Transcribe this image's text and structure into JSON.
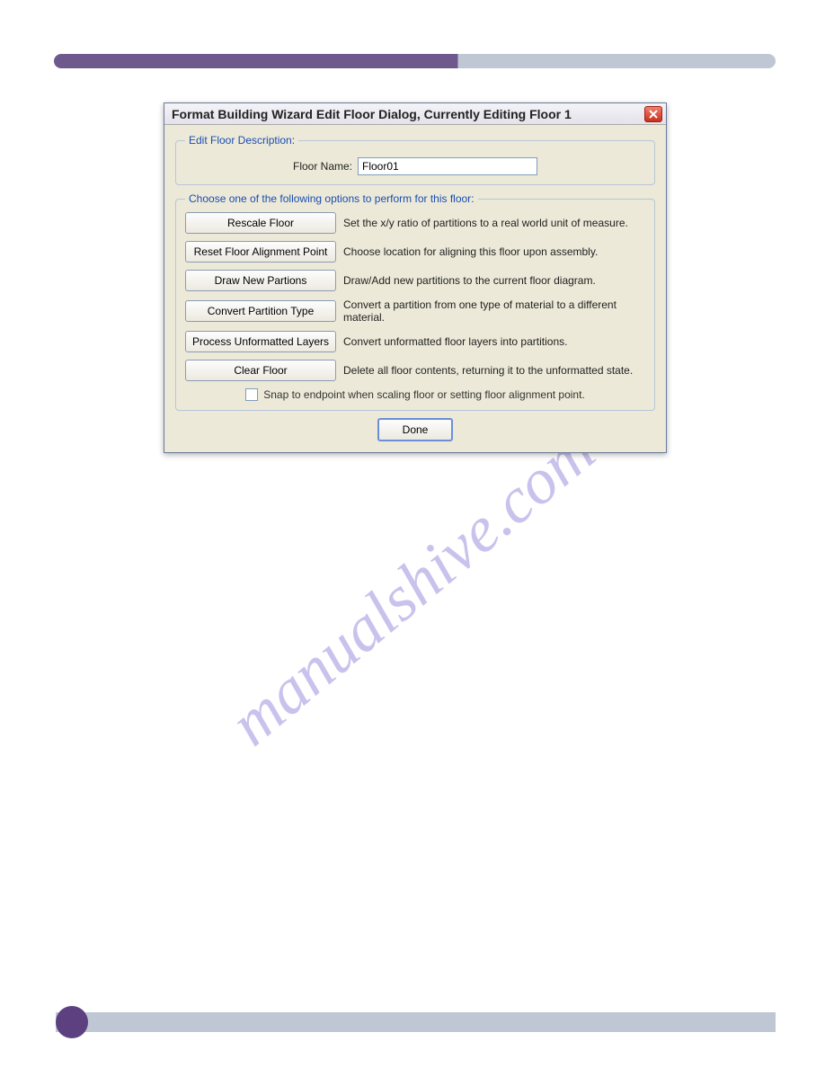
{
  "watermark": "manualshive.com",
  "dialog": {
    "title": "Format Building Wizard Edit Floor Dialog, Currently Editing Floor 1",
    "groups": {
      "description": {
        "legend": "Edit Floor Description:",
        "floorNameLabel": "Floor Name:",
        "floorNameValue": "Floor01"
      },
      "options": {
        "legend": "Choose one of the following options to perform for this floor:",
        "rows": [
          {
            "button": "Rescale Floor",
            "desc": "Set the x/y ratio of partitions to a real world unit of measure."
          },
          {
            "button": "Reset Floor Alignment Point",
            "desc": "Choose location for aligning this floor upon assembly."
          },
          {
            "button": "Draw New Partions",
            "desc": "Draw/Add new partitions to the current floor diagram."
          },
          {
            "button": "Convert Partition Type",
            "desc": "Convert a partition from one type of material to a different material."
          },
          {
            "button": "Process Unformatted Layers",
            "desc": "Convert unformatted floor layers into partitions."
          },
          {
            "button": "Clear Floor",
            "desc": "Delete all floor contents, returning it to the unformatted state."
          }
        ],
        "snapLabel": "Snap to endpoint when scaling floor or setting floor alignment point."
      }
    },
    "doneLabel": "Done"
  }
}
